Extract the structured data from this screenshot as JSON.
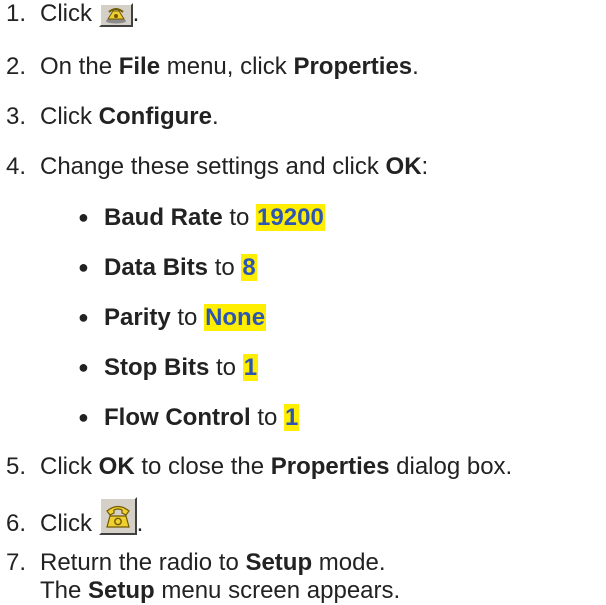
{
  "steps": [
    {
      "num": "1.",
      "pre": "Click",
      "post": ".",
      "icon": "disconnect-phone-icon"
    },
    {
      "num": "2.",
      "pre": "On the ",
      "b1": "File",
      "mid": " menu, click ",
      "b2": "Properties",
      "post": "."
    },
    {
      "num": "3.",
      "pre": "Click ",
      "b1": "Configure",
      "post": "."
    },
    {
      "num": "4.",
      "pre": "Change these settings and click ",
      "b1": "OK",
      "post": ":"
    },
    {
      "num": "5.",
      "pre": "Click ",
      "b1": "OK",
      "mid": " to close the ",
      "b2": "Properties",
      "post": " dialog box."
    },
    {
      "num": "6.",
      "pre": "Click",
      "post": ".",
      "icon": "call-phone-icon"
    },
    {
      "num": "7.",
      "pre": "Return the radio to ",
      "b1": "Setup",
      "post": " mode.",
      "line2_pre": "The ",
      "line2_b": "Setup",
      "line2_post": " menu screen appears."
    }
  ],
  "settings": [
    {
      "name": "Baud Rate",
      "to": "to",
      "value": "19200"
    },
    {
      "name": "Data Bits",
      "to": "to",
      "value": "8"
    },
    {
      "name": "Parity",
      "to": "to",
      "value": "None"
    },
    {
      "name": "Stop Bits",
      "to": "to",
      "value": "1"
    },
    {
      "name": "Flow Control",
      "to": "to",
      "value": "1"
    }
  ],
  "colors": {
    "highlight": "#ffee00",
    "value_text": "#2d56b4",
    "body_text": "#222222"
  }
}
